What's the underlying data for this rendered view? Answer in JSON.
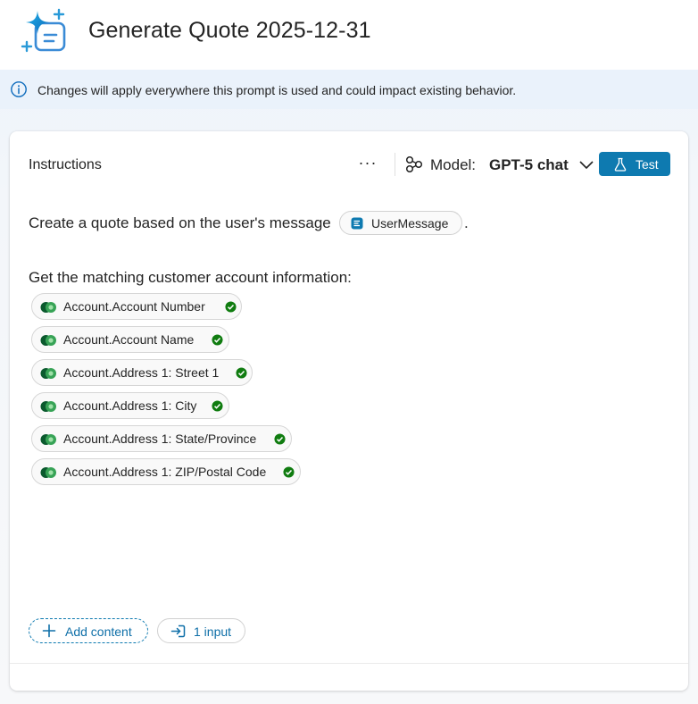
{
  "header": {
    "title": "Generate Quote 2025-12-31",
    "app_icon": "sparkle-document-icon"
  },
  "banner": {
    "icon": "info-icon",
    "text": "Changes will apply everywhere this prompt is used and could impact existing behavior."
  },
  "instructions": {
    "heading": "Instructions",
    "more_label": "···",
    "model_label": "Model:",
    "model_value": "GPT-5 chat",
    "test_label": "Test",
    "line1": "Create a quote based on the user's message",
    "input_chip": "UserMessage",
    "line1_end": ".",
    "line2": "Get the matching customer account information:",
    "fields": [
      {
        "label": "Account.Account Number"
      },
      {
        "label": "Account.Account Name"
      },
      {
        "label": "Account.Address 1: Street 1"
      },
      {
        "label": "Account.Address 1: City"
      },
      {
        "label": "Account.Address 1: State/Province"
      },
      {
        "label": "Account.Address 1: ZIP/Postal Code"
      }
    ],
    "add_content_label": "Add content",
    "inputs_label": "1 input"
  },
  "colors": {
    "accent": "#0e7ab0",
    "check": "#107c10",
    "banner_bg": "#eaf2fb"
  }
}
